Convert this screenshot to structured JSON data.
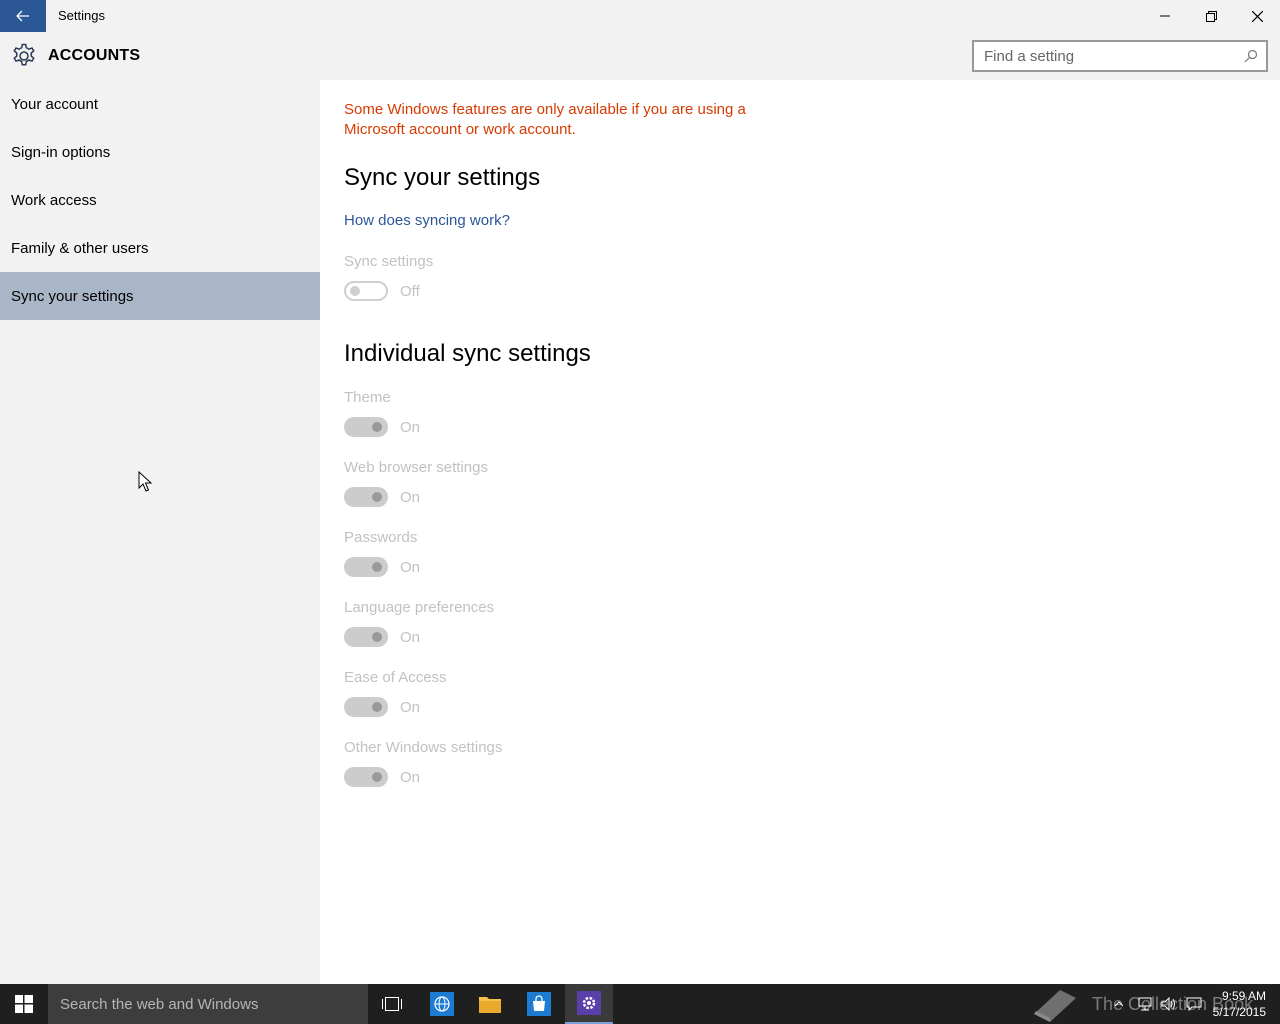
{
  "window": {
    "title": "Settings"
  },
  "header": {
    "title": "ACCOUNTS",
    "search_placeholder": "Find a setting"
  },
  "sidebar": {
    "items": [
      {
        "label": "Your account"
      },
      {
        "label": "Sign-in options"
      },
      {
        "label": "Work access"
      },
      {
        "label": "Family & other users"
      },
      {
        "label": "Sync your settings",
        "selected": true
      }
    ]
  },
  "main": {
    "warning_line1": "Some Windows features are only available if you are using a",
    "warning_line2": "Microsoft account or work account.",
    "sync_title": "Sync your settings",
    "help_link": "How does syncing work?",
    "sync_settings": {
      "label": "Sync settings",
      "state": "Off"
    },
    "individual_title": "Individual sync settings",
    "individual": [
      {
        "label": "Theme",
        "state": "On"
      },
      {
        "label": "Web browser settings",
        "state": "On"
      },
      {
        "label": "Passwords",
        "state": "On"
      },
      {
        "label": "Language preferences",
        "state": "On"
      },
      {
        "label": "Ease of Access",
        "state": "On"
      },
      {
        "label": "Other Windows settings",
        "state": "On"
      }
    ]
  },
  "taskbar": {
    "search_text": "Search the web and Windows",
    "watermark": "The Collection Book",
    "time": "9:59 AM",
    "date": "5/17/2015"
  },
  "colors": {
    "accent": "#2b5797",
    "warning": "#d83b01",
    "selected_nav": "#a9b6c8"
  }
}
